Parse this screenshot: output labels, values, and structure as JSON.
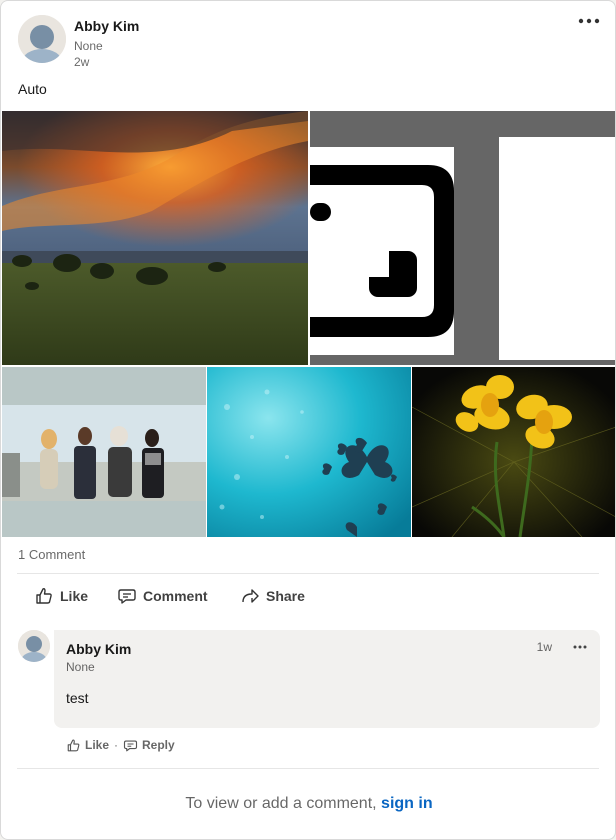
{
  "post": {
    "author_name": "Abby Kim",
    "author_headline": "None",
    "time": "2w",
    "text": "Auto"
  },
  "images": [
    {
      "subject": "sunset-landscape"
    },
    {
      "subject": "crop-icon-graphic"
    },
    {
      "subject": "tv-show-cast"
    },
    {
      "subject": "butterflies-on-teal"
    },
    {
      "subject": "yellow-daffodil"
    }
  ],
  "social": {
    "comments_count": "1 Comment"
  },
  "actions": {
    "like": "Like",
    "comment": "Comment",
    "share": "Share"
  },
  "comment": {
    "author_name": "Abby Kim",
    "author_headline": "None",
    "time": "1w",
    "text": "test",
    "like_label": "Like",
    "separator": "·",
    "reply_label": "Reply"
  },
  "footer": {
    "prompt": "To view or add a comment,",
    "link": "sign in"
  },
  "colors": {
    "link_blue": "#0a66c2",
    "bubble_bg": "#f2f1ef"
  }
}
